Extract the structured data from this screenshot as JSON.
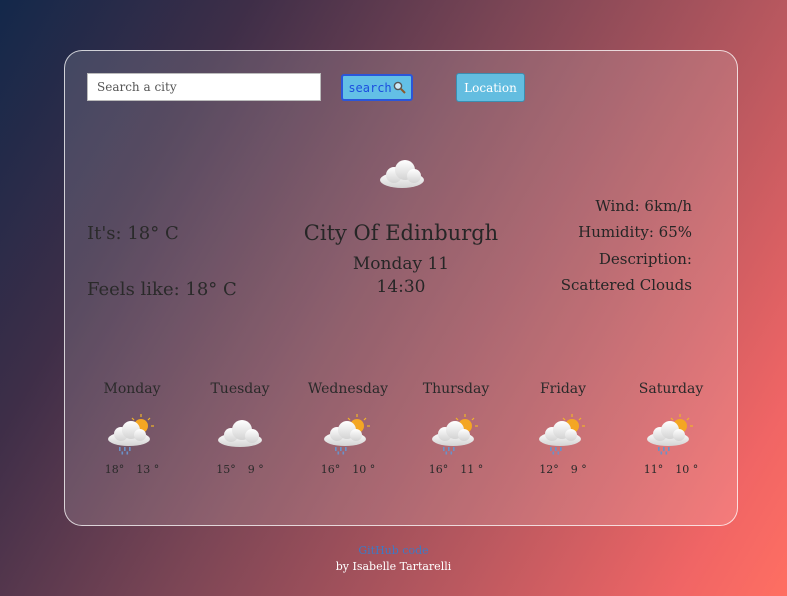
{
  "search": {
    "placeholder": "Search a city",
    "button_label": "search",
    "location_label": "Location"
  },
  "current": {
    "its": "It's: 18° C",
    "feels": "Feels like: 18° C",
    "city": "City Of Edinburgh",
    "day": "Monday 11",
    "time": "14:30",
    "wind": "Wind: 6km/h",
    "humidity": "Humidity: 65%",
    "description_label": "Description:",
    "description": "Scattered Clouds",
    "icon": "cloud-icon"
  },
  "forecast": [
    {
      "day": "Monday",
      "high": "18°",
      "low": "13 °",
      "icon": "rain-sun-icon"
    },
    {
      "day": "Tuesday",
      "high": "15°",
      "low": "9 °",
      "icon": "cloud-icon"
    },
    {
      "day": "Wednesday",
      "high": "16°",
      "low": "10 °",
      "icon": "rain-sun-icon"
    },
    {
      "day": "Thursday",
      "high": "16°",
      "low": "11 °",
      "icon": "rain-sun-icon"
    },
    {
      "day": "Friday",
      "high": "12°",
      "low": "9 °",
      "icon": "rain-sun-icon"
    },
    {
      "day": "Saturday",
      "high": "11°",
      "low": "10 °",
      "icon": "rain-sun-icon"
    }
  ],
  "footer": {
    "github": "GitHub code",
    "by": "by Isabelle Tartarelli"
  },
  "colors": {
    "button": "#63c0e6",
    "search_border": "#2b56d9",
    "link": "#3d79c4"
  }
}
